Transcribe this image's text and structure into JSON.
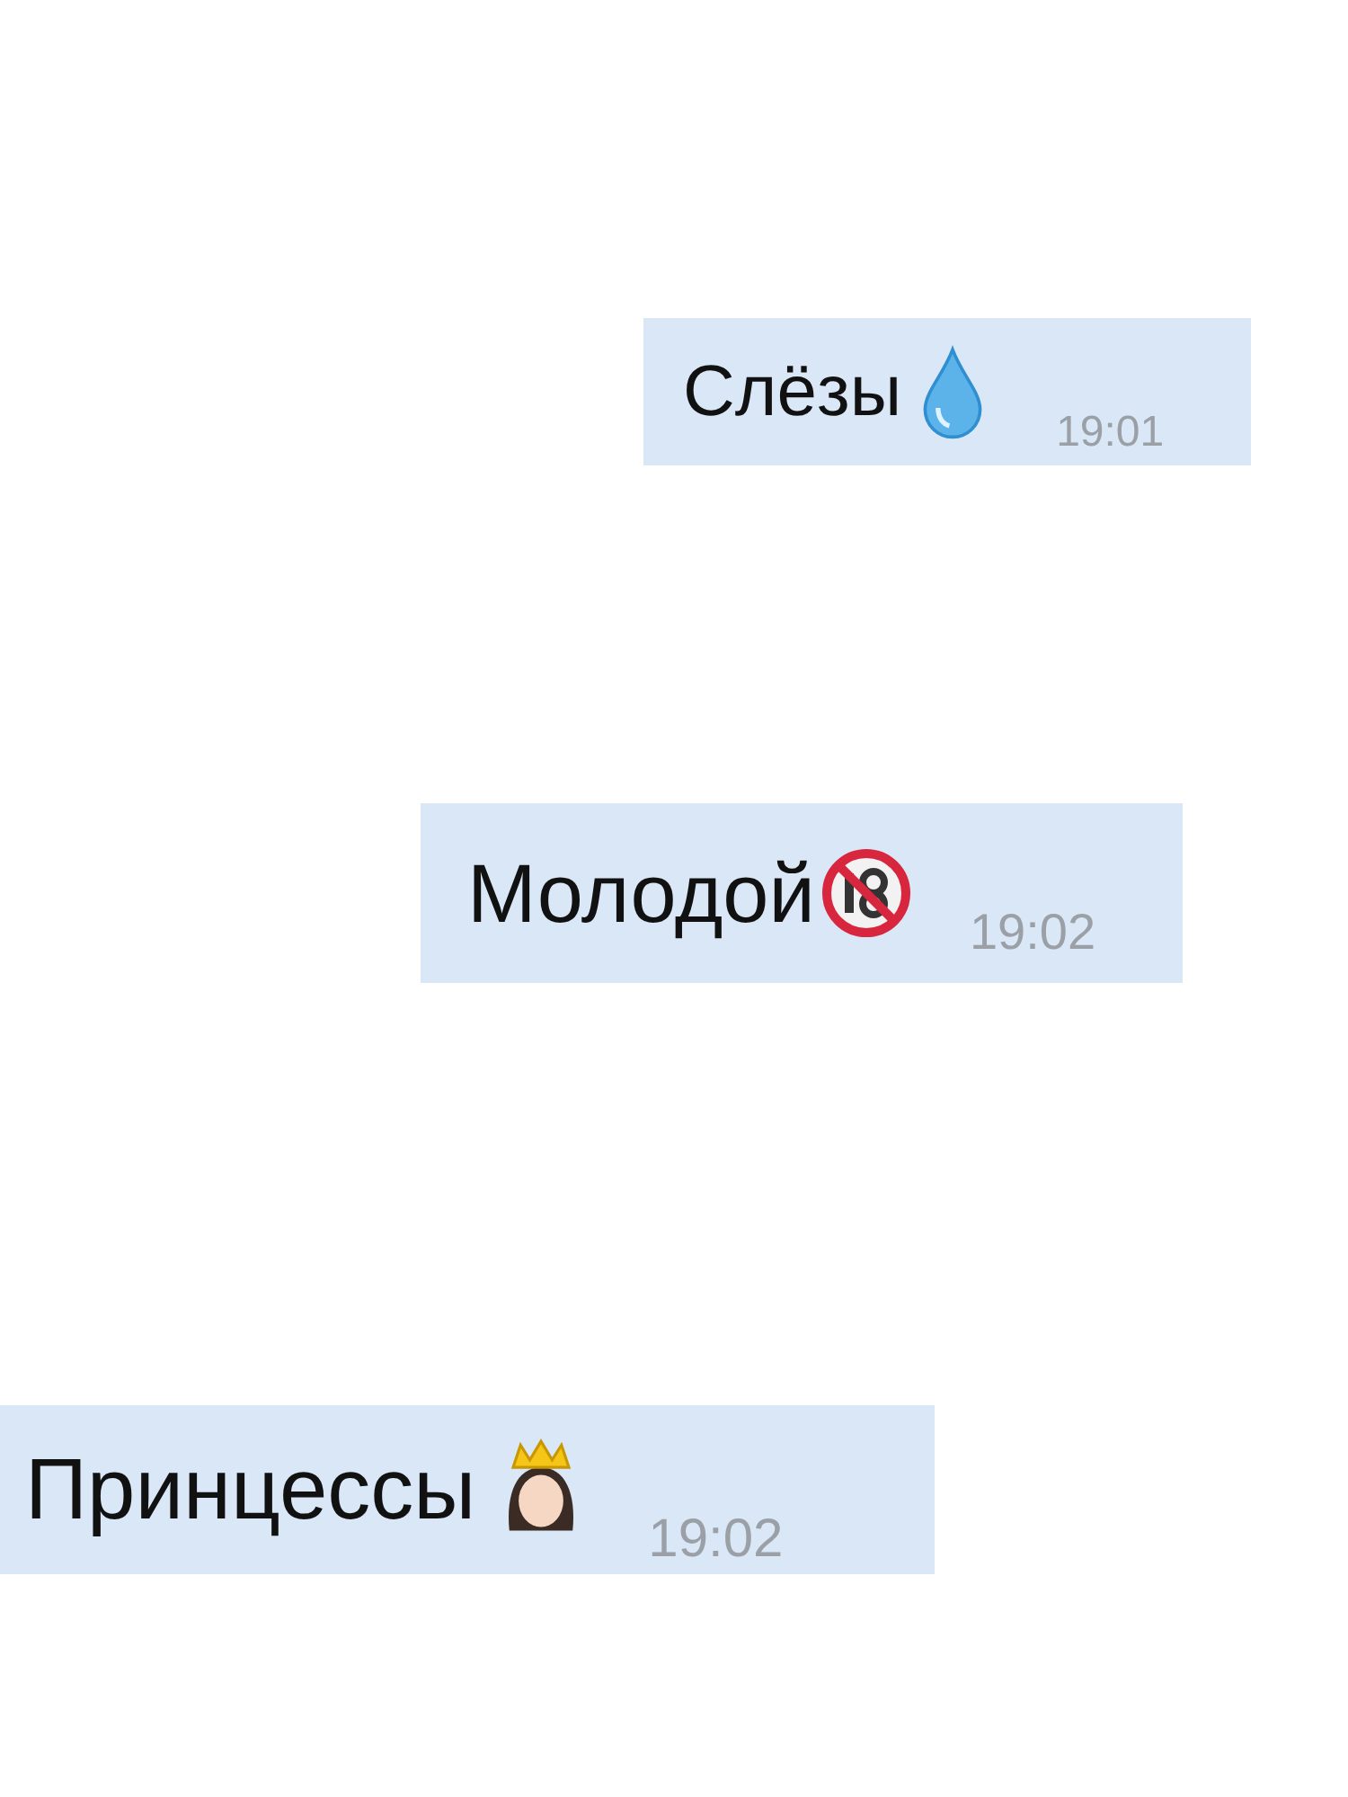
{
  "messages": [
    {
      "text": "Слёзы",
      "kind": "drop",
      "time": "19:01"
    },
    {
      "text": "Молодой",
      "kind": "no-under-18",
      "time": "19:02"
    },
    {
      "text": "Принцессы",
      "kind": "princess",
      "time": "19:02"
    }
  ]
}
